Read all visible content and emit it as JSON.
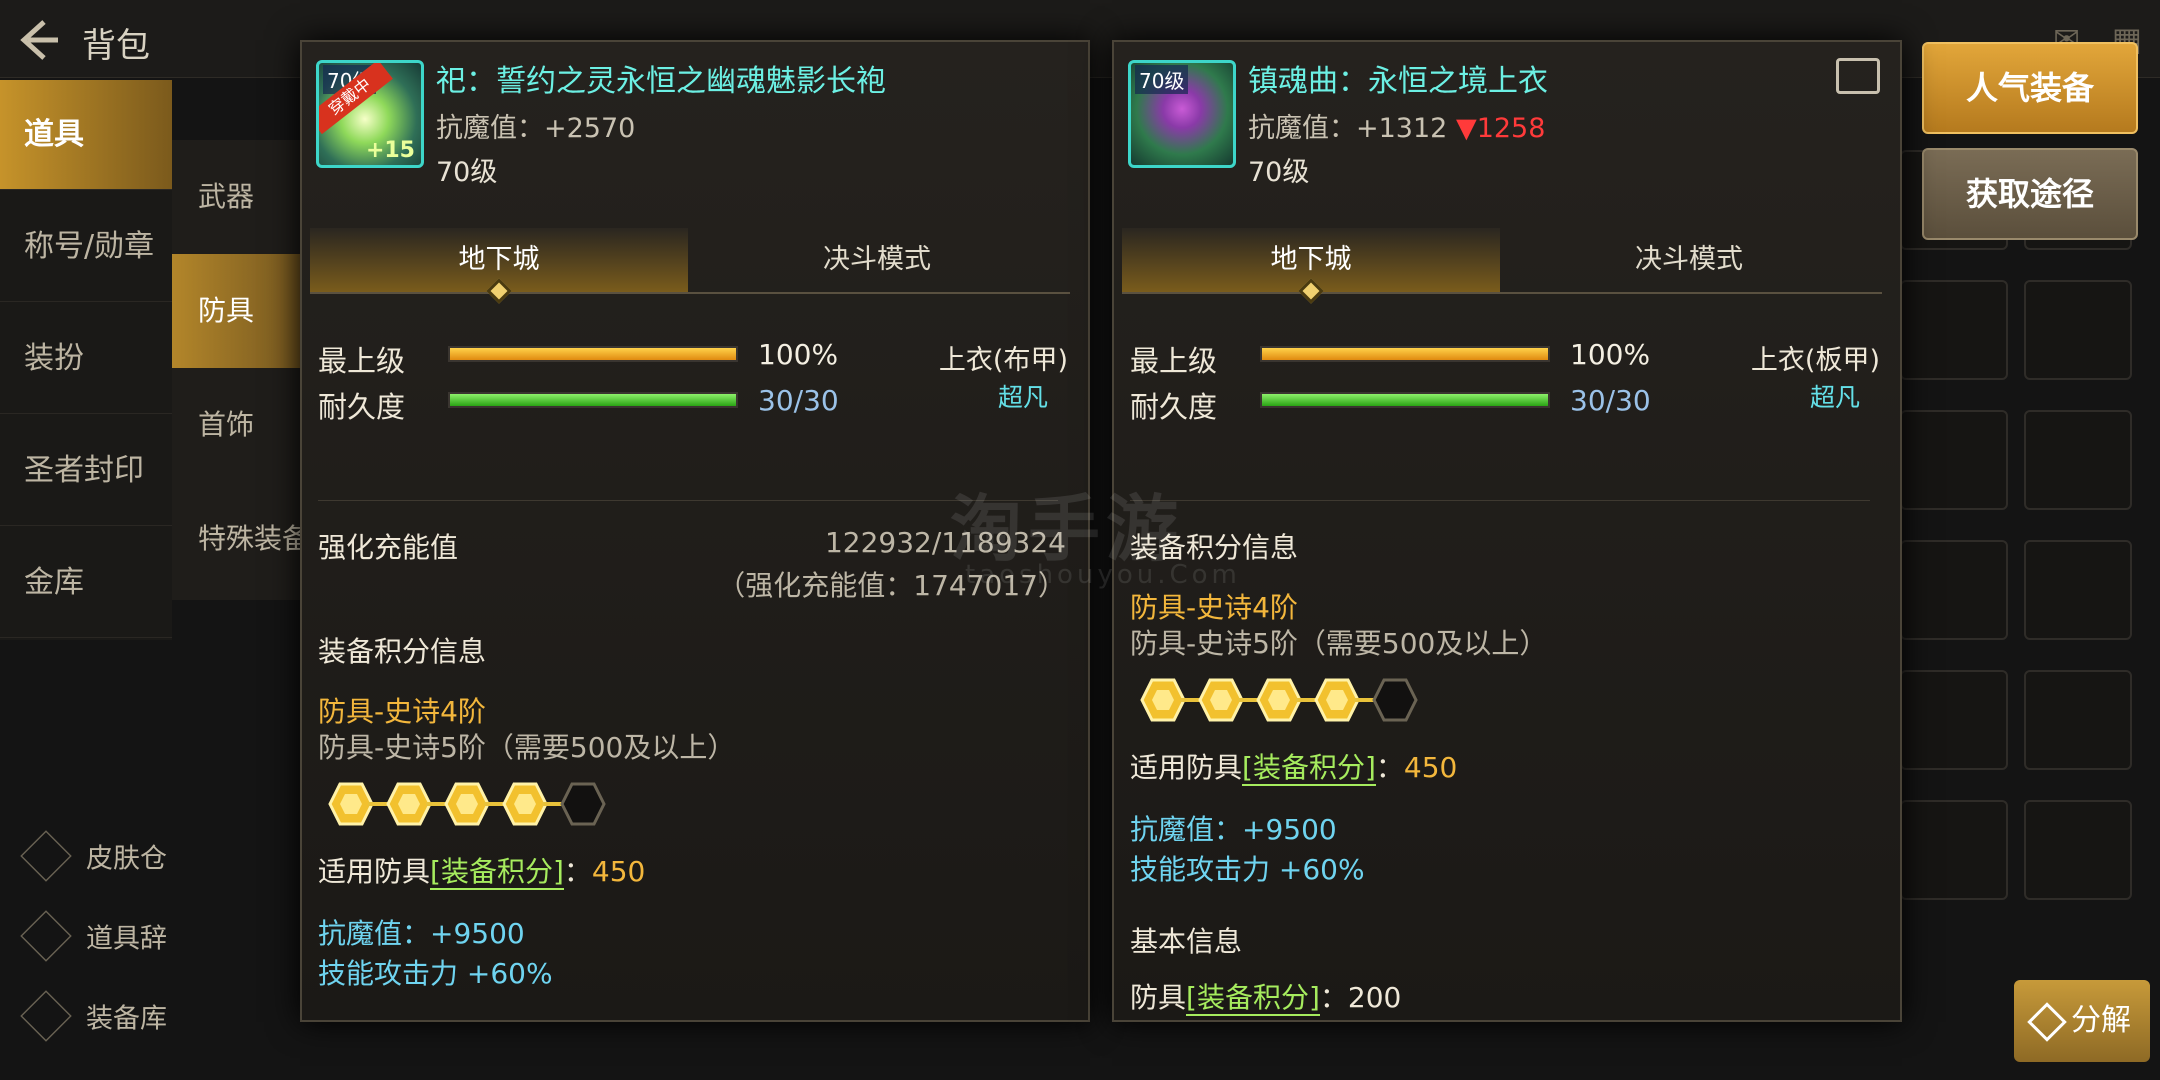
{
  "topbar": {
    "title": "背包",
    "back_icon": "arrow-left-icon",
    "mail_icon": "mail-icon",
    "menu_icon": "grid-menu-icon"
  },
  "left_nav": {
    "items": [
      {
        "label": "道具",
        "active": true
      },
      {
        "label": "称号/勋章",
        "active": false
      },
      {
        "label": "装扮",
        "active": false
      },
      {
        "label": "圣者封印",
        "active": false
      },
      {
        "label": "金库",
        "active": false
      }
    ]
  },
  "sub_nav": {
    "items": [
      {
        "label": "武器",
        "active": false
      },
      {
        "label": "防具",
        "active": true
      },
      {
        "label": "首饰",
        "active": false
      },
      {
        "label": "特殊装备",
        "active": false
      }
    ]
  },
  "bottom_left": {
    "items": [
      {
        "label": "皮肤仓",
        "icon": "brush-icon"
      },
      {
        "label": "道具辞",
        "icon": "dictionary-icon"
      },
      {
        "label": "装备库",
        "icon": "armor-icon"
      }
    ]
  },
  "right_buttons": {
    "popular": "人气装备",
    "source": "获取途径",
    "decompose": "分解"
  },
  "watermark": {
    "main": "淘手游",
    "sub": "taoshouyou.Com"
  },
  "left_panel": {
    "badge": "穿戴中",
    "icon_level_tag": "70级",
    "icon_count": "+15",
    "name": "祀：誓约之灵永恒之幽魂魅影长袍",
    "resist_label": "抗魔值：",
    "resist_value": "+2570",
    "level": "70级",
    "tabs": [
      "地下城",
      "决斗模式"
    ],
    "grade_label": "最上级",
    "grade_value": "100%",
    "grade_ratio": 1.0,
    "durability_label": "耐久度",
    "durability_value": "30/30",
    "durability_ratio": 1.0,
    "slot_type": "上衣(布甲)",
    "rarity": "超凡",
    "charge_label": "强化充能值",
    "charge_value": "122932/1189324",
    "charge_total": "（强化充能值：1747017）",
    "score_section": "装备积分信息",
    "tier_current": "防具-史诗4阶",
    "tier_next": "防具-史诗5阶（需要500及以上）",
    "hex_filled": 4,
    "hex_total": 5,
    "score_prefix": "适用防具",
    "score_tag": "[装备积分]",
    "score_colon": "：",
    "score_value": "450",
    "bonus_resist": "抗魔值：+9500",
    "bonus_skill": "技能攻击力 +60%"
  },
  "right_panel": {
    "icon_level_tag": "70级",
    "name": "镇魂曲：永恒之境上衣",
    "resist_label": "抗魔值：",
    "resist_value": "+1312",
    "resist_diff": "▼1258",
    "level": "70级",
    "share_icon": "share-icon",
    "tabs": [
      "地下城",
      "决斗模式"
    ],
    "grade_label": "最上级",
    "grade_value": "100%",
    "grade_ratio": 1.0,
    "durability_label": "耐久度",
    "durability_value": "30/30",
    "durability_ratio": 1.0,
    "slot_type": "上衣(板甲)",
    "rarity": "超凡",
    "score_section": "装备积分信息",
    "tier_current": "防具-史诗4阶",
    "tier_next": "防具-史诗5阶（需要500及以上）",
    "hex_filled": 4,
    "hex_total": 5,
    "score_prefix": "适用防具",
    "score_tag": "[装备积分]",
    "score_colon": "：",
    "score_value": "450",
    "bonus_resist": "抗魔值：+9500",
    "bonus_skill": "技能攻击力 +60%",
    "basic_section": "基本信息",
    "basic_prefix": "防具",
    "basic_tag": "[装备积分]",
    "basic_colon": "：",
    "basic_value": "200"
  },
  "colors": {
    "gold": "#f3b73c",
    "cyan_name": "#6cf0e4",
    "bonus_blue": "#6fd4f0",
    "down_red": "#ff3a3a",
    "tag_green": "#a6ec5e"
  }
}
